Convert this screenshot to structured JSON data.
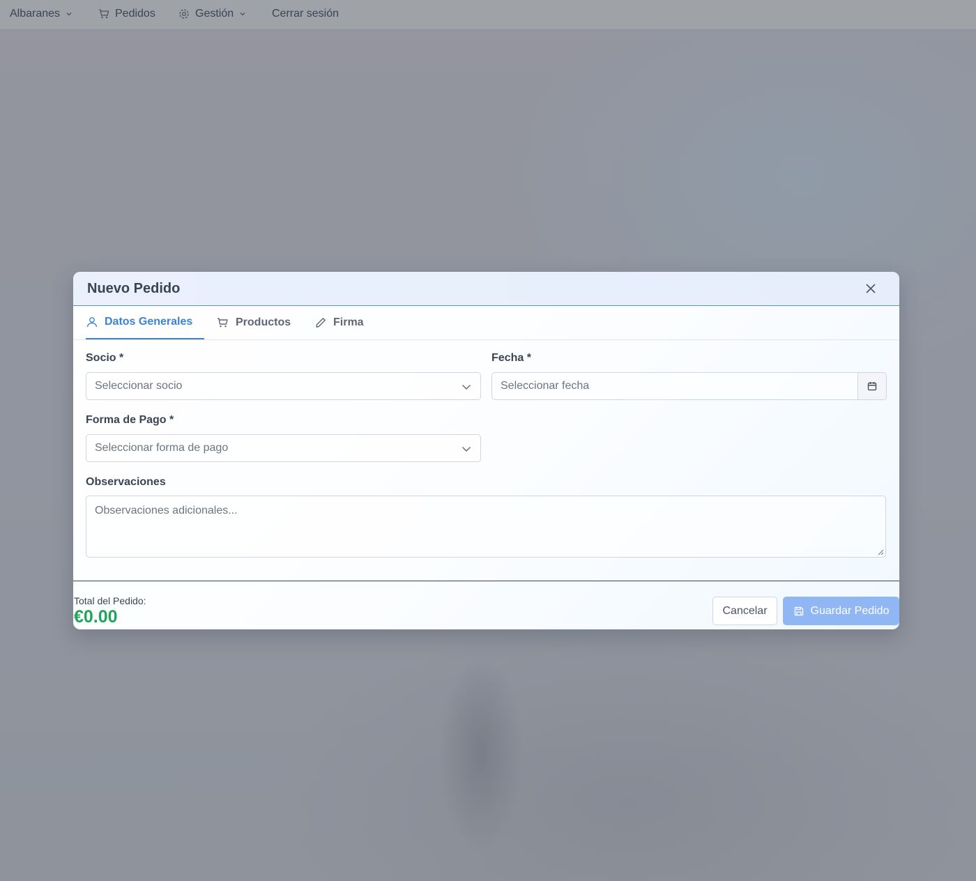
{
  "nav": {
    "albaranes": "Albaranes",
    "pedidos": "Pedidos",
    "gestion": "Gestión",
    "cerrar_sesion": "Cerrar sesión"
  },
  "modal": {
    "title": "Nuevo Pedido",
    "tabs": [
      {
        "label": "Datos Generales",
        "icon": "user-icon",
        "active": true
      },
      {
        "label": "Productos",
        "icon": "cart-icon",
        "active": false
      },
      {
        "label": "Firma",
        "icon": "pencil-icon",
        "active": false
      }
    ],
    "form": {
      "socio_label": "Socio *",
      "socio_placeholder": "Seleccionar socio",
      "fecha_label": "Fecha *",
      "fecha_placeholder": "Seleccionar fecha",
      "forma_pago_label": "Forma de Pago *",
      "forma_pago_placeholder": "Seleccionar forma de pago",
      "observaciones_label": "Observaciones",
      "observaciones_placeholder": "Observaciones adicionales..."
    },
    "footer": {
      "total_label": "Total del Pedido:",
      "total_value": "€0.00",
      "cancel_label": "Cancelar",
      "save_label": "Guardar Pedido"
    }
  },
  "colors": {
    "accent": "#3b82d6",
    "total_green": "#1fa65a",
    "save_button": "#90b7f3"
  }
}
